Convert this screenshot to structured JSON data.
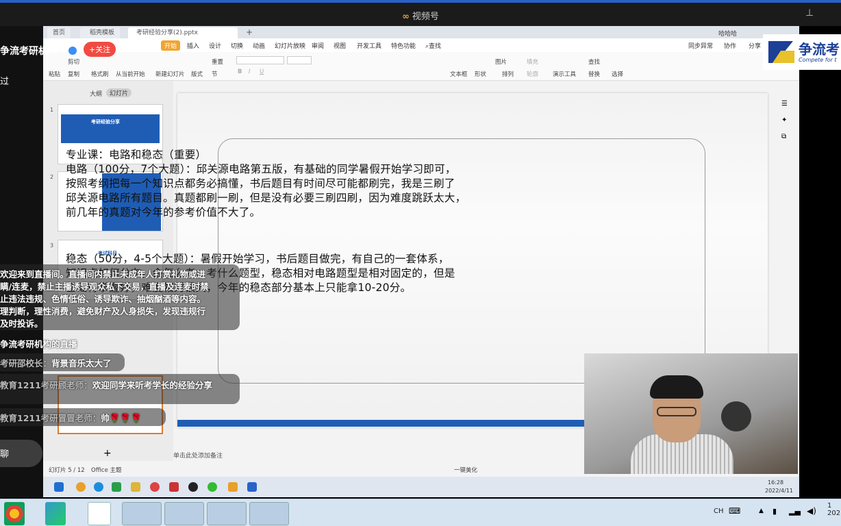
{
  "window": {
    "title": "视频号",
    "ctl_pin": "⊥",
    "ctl_min": "—",
    "ctl_close": "✕"
  },
  "wps": {
    "tabs": [
      "首页",
      "稻壳模板",
      "考研经验分享(2).pptx"
    ],
    "user": "哈哈哈",
    "menu": [
      "开始",
      "插入",
      "设计",
      "切换",
      "动画",
      "幻灯片放映",
      "审阅",
      "视图",
      "开发工具",
      "特色功能",
      "查找"
    ],
    "menu_right": [
      "同步异常",
      "协作",
      "分享"
    ],
    "ribbon": {
      "paste": "粘贴",
      "cut": "剪切",
      "copy": "复制",
      "format_painter": "格式刷",
      "play_from_current": "从当前开始",
      "new_slide": "新建幻灯片",
      "layout": "版式",
      "section": "节",
      "reset": "重置",
      "textbox": "文本框",
      "shape": "形状",
      "arrange": "排列",
      "picture": "图片",
      "fill": "填充",
      "outline": "轮廓",
      "presenter": "演示工具",
      "find": "查找",
      "replace": "替换",
      "select": "选择"
    },
    "panel_tabs": [
      "大纲",
      "幻灯片"
    ],
    "thumbnails": [
      {
        "num": "1",
        "title": "考研经验分享"
      },
      {
        "num": "2",
        "title": ""
      },
      {
        "num": "3",
        "title": "考试科目"
      }
    ],
    "add_slide": "+",
    "notes_placeholder": "单击此处添加备注",
    "status_slide": "幻灯片 5 / 12",
    "status_theme": "Office 主题",
    "beautify": "一键美化",
    "inner_time": "16:28",
    "inner_date": "2022/4/11"
  },
  "slide": {
    "p1_lines": [
      "专业课：电路和稳态（重要）",
      "电路（100分，7个大题）：邱关源电路第五版，有基础的同学暑假开始学习即可，",
      "按照考纲把每一个知识点都务必搞懂，书后题目有时间尽可能都刷完，我是三刷了",
      "邱关源电路所有题目。真题都刷一刷，但是没有必要三刷四刷，因为难度跳跃太大，",
      "前几年的真题对今年的参考价值不大了。"
    ],
    "p2_lines": [
      "稳态（50分，4-5个大题）：暑假开始学习，书后题目做完，有自己的一套体系，",
      "知识点如何分布，会怎么考，考什么题型，稳态相对电路题型是相对固定的，但是",
      "基础得掌握好，难度相对很大，今年的稳态部分基本上只能拿10-20分。"
    ]
  },
  "live": {
    "streamer": "争流考研机构",
    "follow": "+关注",
    "passed": "过",
    "say_placeholder": "聊",
    "notice_lines": [
      "欢迎来到直播间。直播间内禁止未成年人打赏礼物或进",
      "瞒/连麦，禁止主播诱导观众私下交易，直播及连麦时禁",
      "止违法违规、色情低俗、诱导欺诈、抽烟酗酒等内容。",
      "理判断，理性消费，避免财产及人身损失，发现违规行",
      "及时投诉。"
    ],
    "chats": [
      {
        "user": "",
        "text": "争流考研机构的直播"
      },
      {
        "user": "考研邵校长",
        "text": "背景音乐太大了"
      },
      {
        "user": "教育1211考研顾老师",
        "text": "欢迎同学来听考学长的经验分享"
      },
      {
        "user": "教育1211考研冒冒老师",
        "text": "帅🌹🌹🌹"
      }
    ]
  },
  "brand": {
    "name": "争流考",
    "sub": "Compete for t"
  },
  "taskbar": {
    "ime": "CH",
    "clock_hour": "1",
    "clock_year": "202"
  },
  "colors": {
    "accent": "#2a62c9",
    "wps_orange": "#f0a530",
    "follow_red": "#f04b42",
    "slide_blue": "#1f5db5"
  }
}
